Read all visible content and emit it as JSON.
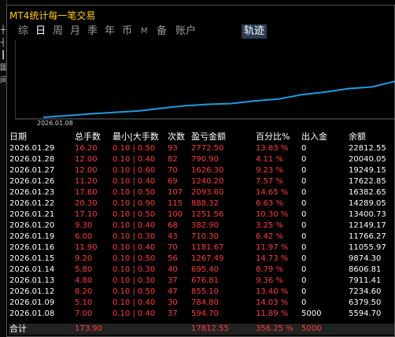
{
  "window": {
    "title": "MT4统计每一笔交易"
  },
  "left_strip_glyphs": [
    "┼",
    "┤",
    "┃",
    "固",
    "间"
  ],
  "tabs": [
    {
      "label": "综",
      "active": false
    },
    {
      "label": "日",
      "active": true
    },
    {
      "label": "周",
      "active": false
    },
    {
      "label": "月",
      "active": false
    },
    {
      "label": "季",
      "active": false
    },
    {
      "label": "年",
      "active": false
    },
    {
      "label": "币",
      "active": false
    },
    {
      "label": "M",
      "active": false
    },
    {
      "label": "备",
      "active": false
    },
    {
      "label": "账户",
      "active": false
    },
    {
      "label": "轨迹",
      "active": true
    }
  ],
  "chart_data": {
    "type": "line",
    "x_start_label": "2026.01.08",
    "line_color": "#1e9be0",
    "x": [
      "2026.01.08",
      "2026.01.09",
      "2026.01.12",
      "2026.01.13",
      "2026.01.14",
      "2026.01.15",
      "2026.01.16",
      "2026.01.19",
      "2026.01.20",
      "2026.01.21",
      "2026.01.22",
      "2026.01.23",
      "2026.01.26",
      "2026.01.27",
      "2026.01.28",
      "2026.01.29"
    ],
    "values": [
      5594.7,
      6379.5,
      7234.6,
      7911.41,
      8606.81,
      9874.3,
      11055.97,
      11766.27,
      12149.17,
      13400.73,
      14289.05,
      16382.65,
      17622.85,
      19249.15,
      20040.05,
      22812.55
    ]
  },
  "table": {
    "headers": [
      "日期",
      "总手数",
      "最小|大手数",
      "次数",
      "盈亏金额",
      "百分比%",
      "出入金",
      "余额"
    ],
    "rows": [
      [
        "2026.01.29",
        "16.20",
        "0.10 | 0.50",
        "93",
        "2772.50",
        "13.83 %",
        "0",
        "22812.55"
      ],
      [
        "2026.01.28",
        "12.00",
        "0.10 | 0.40",
        "82",
        "790.90",
        "4.11 %",
        "0",
        "20040.05"
      ],
      [
        "2026.01.27",
        "12.00",
        "0.10 | 0.60",
        "70",
        "1626.30",
        "9.23 %",
        "0",
        "19249.15"
      ],
      [
        "2026.01.26",
        "11.20",
        "0.10 | 0.40",
        "69",
        "1240.20",
        "7.57 %",
        "0",
        "17622.85"
      ],
      [
        "2026.01.23",
        "17.60",
        "0.10 | 0.50",
        "107",
        "2093.60",
        "14.65 %",
        "0",
        "16382.65"
      ],
      [
        "2026.01.22",
        "20.30",
        "0.10 | 0.90",
        "115",
        "888.32",
        "6.63 %",
        "0",
        "14289.05"
      ],
      [
        "2026.01.21",
        "17.10",
        "0.10 | 0.50",
        "100",
        "1251.56",
        "10.30 %",
        "0",
        "13400.73"
      ],
      [
        "2026.01.20",
        "9.30",
        "0.10 | 0.40",
        "68",
        "382.90",
        "3.25 %",
        "0",
        "12149.17"
      ],
      [
        "2026.01.19",
        "6.00",
        "0.10 | 0.30",
        "43",
        "710.30",
        "6.42 %",
        "0",
        "11766.27"
      ],
      [
        "2026.01.16",
        "11.90",
        "0.10 | 0.40",
        "70",
        "1181.67",
        "11.97 %",
        "0",
        "11055.97"
      ],
      [
        "2026.01.15",
        "9.20",
        "0.10 | 0.50",
        "56",
        "1267.49",
        "14.73 %",
        "0",
        "9874.30"
      ],
      [
        "2026.01.14",
        "5.80",
        "0.10 | 0.30",
        "40",
        "695.40",
        "8.79 %",
        "0",
        "8606.81"
      ],
      [
        "2026.01.13",
        "4.80",
        "0.10 | 0.30",
        "37",
        "676.81",
        "9.36 %",
        "0",
        "7911.41"
      ],
      [
        "2026.01.12",
        "8.20",
        "0.10 | 0.50",
        "47",
        "855.10",
        "13.40 %",
        "0",
        "7234.60"
      ],
      [
        "2026.01.09",
        "5.10",
        "0.10 | 0.40",
        "30",
        "784.80",
        "14.03 %",
        "0",
        "6379.50"
      ],
      [
        "2026.01.08",
        "7.00",
        "0.10 | 0.40",
        "37",
        "594.70",
        "11.89 %",
        "5000",
        "5594.70"
      ]
    ],
    "total": {
      "label": "合计",
      "lots": "173.90",
      "pnl": "17812.55",
      "pct": "356.25 %",
      "io": "5000"
    }
  }
}
